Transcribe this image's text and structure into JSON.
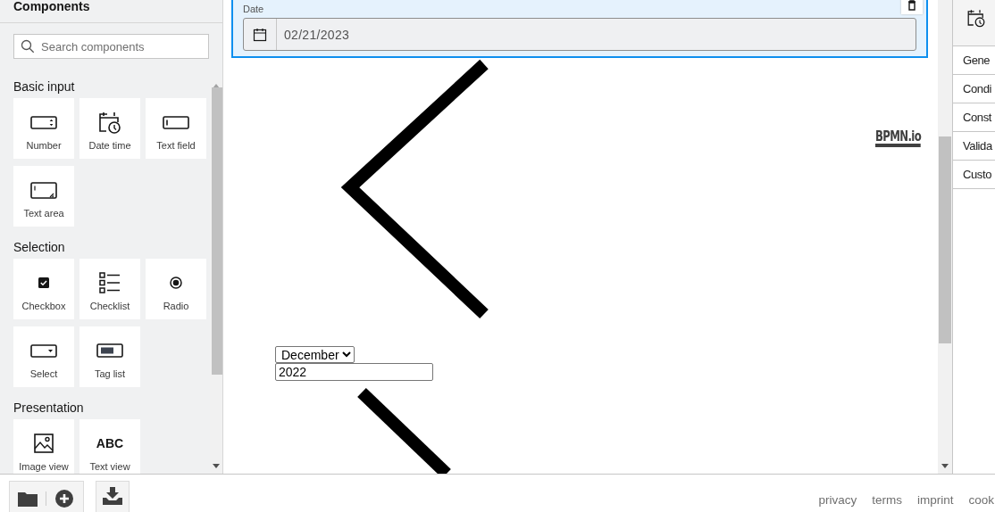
{
  "sidebar": {
    "title": "Components",
    "search": {
      "placeholder": "Search components"
    },
    "groups": [
      {
        "title": "Basic input",
        "items": [
          {
            "label": "Number",
            "kind": "number"
          },
          {
            "label": "Date time",
            "kind": "datetime"
          },
          {
            "label": "Text field",
            "kind": "textfield"
          },
          {
            "label": "Text area",
            "kind": "textarea"
          }
        ]
      },
      {
        "title": "Selection",
        "items": [
          {
            "label": "Checkbox",
            "kind": "checkbox"
          },
          {
            "label": "Checklist",
            "kind": "checklist"
          },
          {
            "label": "Radio",
            "kind": "radio"
          },
          {
            "label": "Select",
            "kind": "select"
          },
          {
            "label": "Tag list",
            "kind": "taglist"
          }
        ]
      },
      {
        "title": "Presentation",
        "items": [
          {
            "label": "Image view",
            "kind": "image"
          },
          {
            "label": "Text view",
            "kind": "text",
            "glyph": "ABC"
          }
        ]
      }
    ]
  },
  "canvas": {
    "field": {
      "label": "Date",
      "value": "02/21/2023",
      "selected": true
    },
    "month_select": {
      "value": "December"
    },
    "year_input": {
      "value": "2022"
    },
    "logo": "BPMN.io"
  },
  "properties": {
    "groups": [
      "Gene",
      "Condi",
      "Const",
      "Valida",
      "Custo"
    ]
  },
  "footer": {
    "links": [
      "privacy",
      "terms",
      "imprint",
      "cook"
    ]
  }
}
